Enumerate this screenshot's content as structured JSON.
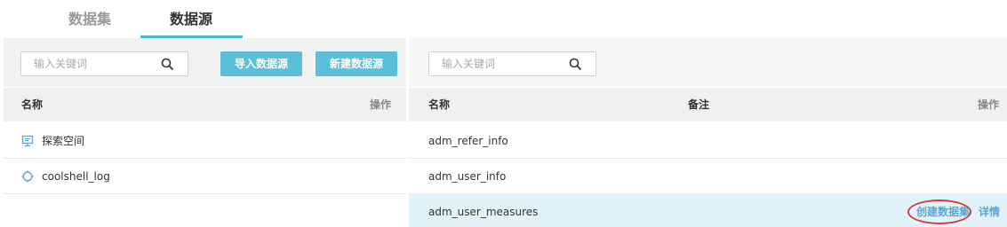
{
  "tabs": [
    {
      "label": "数据集",
      "active": false
    },
    {
      "label": "数据源",
      "active": true
    }
  ],
  "left": {
    "search": {
      "placeholder": "输入关键词",
      "icon": "search-icon"
    },
    "buttons": {
      "import_label": "导入数据源",
      "new_label": "新建数据源"
    },
    "columns": {
      "name": "名称",
      "op": "操作"
    },
    "rows": [
      {
        "name": "探索空间",
        "icon": "monitor-icon"
      },
      {
        "name": "coolshell_log",
        "icon": "crosshair-icon"
      }
    ]
  },
  "right": {
    "search": {
      "placeholder": "输入关键词",
      "icon": "search-icon"
    },
    "columns": {
      "name": "名称",
      "note": "备注",
      "op": "操作"
    },
    "rows": [
      {
        "name": "adm_refer_info"
      },
      {
        "name": "adm_user_info"
      },
      {
        "name": "adm_user_measures",
        "actions": {
          "create": "创建数据集",
          "detail": "详情"
        }
      }
    ]
  },
  "colors": {
    "accent": "#5bbfd9",
    "link": "#5aa7d6",
    "highlight": "#e1f3f8",
    "annotation": "#d23c3c"
  }
}
